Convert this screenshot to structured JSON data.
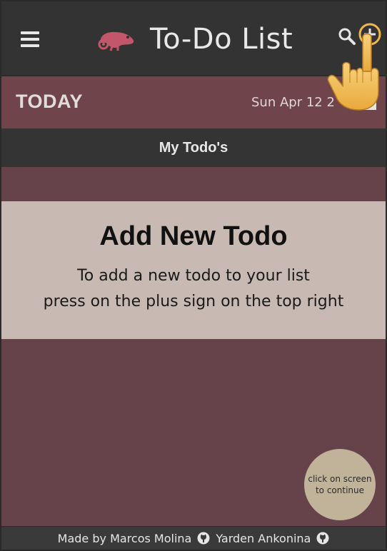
{
  "header": {
    "title": "To-Do List",
    "menu_icon": "hamburger-menu-icon",
    "logo_icon": "chameleon-logo-icon",
    "search_icon": "search-icon",
    "add_icon": "plus-circle-icon"
  },
  "today": {
    "label": "TODAY",
    "date": "Sun Apr 12 2",
    "calendar_icon": "calendar-icon"
  },
  "section": {
    "title": "My Todo's"
  },
  "empty_state": {
    "title": "Add New Todo",
    "line1": "To add a new todo to your list",
    "line2": "press on the plus sign on the top right"
  },
  "continue": {
    "label": "click on screen to continue"
  },
  "footer": {
    "prefix": "Made by Marcos Molina",
    "author2": "Yarden Ankonina",
    "icon": "github-icon"
  },
  "overlay": {
    "hand_icon": "pointing-hand-icon"
  },
  "colors": {
    "header_bg": "#333333",
    "today_bg": "#6f444b",
    "body_bg": "#66424a",
    "card_bg": "#c9b9b3",
    "accent": "#f0b64a",
    "bubble_bg": "#c1b29a"
  }
}
